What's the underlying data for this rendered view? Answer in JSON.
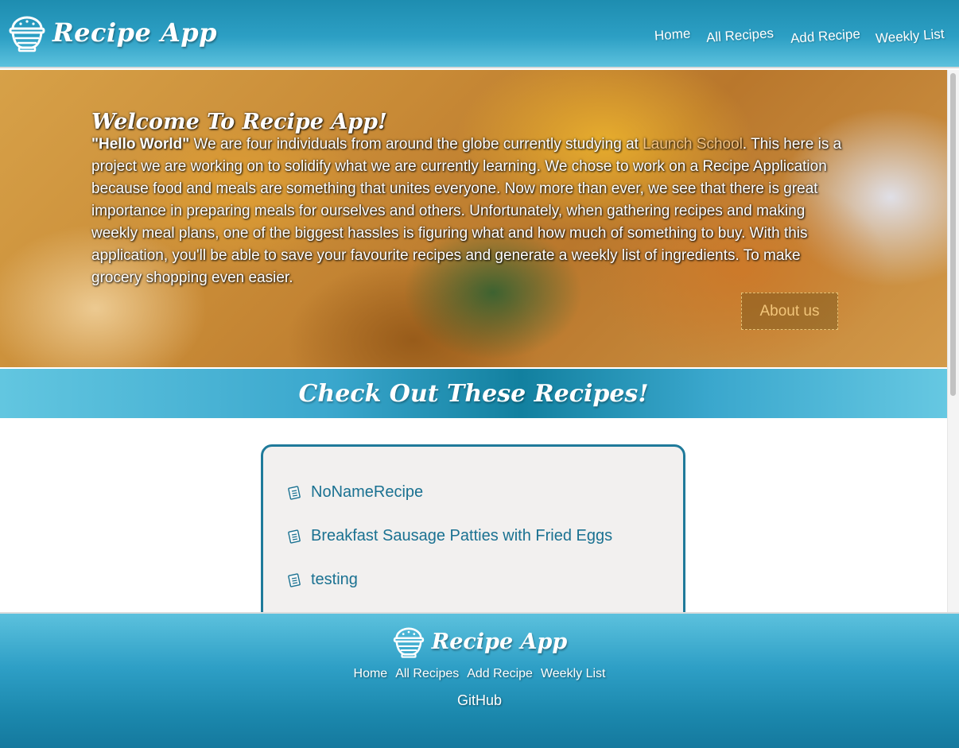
{
  "header": {
    "brand": "Recipe App",
    "nav": [
      "Home",
      "All Recipes",
      "Add Recipe",
      "Weekly List"
    ]
  },
  "hero": {
    "title": "Welcome To Recipe App!",
    "greeting": "\"Hello World\"",
    "intro": " We are four individuals from around the globe currently studying at ",
    "school_link": "Launch School",
    "body": ". This here is a project we are working on to solidify what we are currently learning. We chose to work on a Recipe Application because food and meals are something that unites everyone. Now more than ever, we see that there is great importance in preparing meals for ourselves and others. Unfortunately, when gathering recipes and making weekly meal plans, one of the biggest hassles is figuring what and how much of something to buy. With this application, you'll be able to save your favourite recipes and generate a weekly list of ingredients. To make grocery shopping even easier.",
    "about_button": "About us"
  },
  "section": {
    "title": "Check Out These Recipes!"
  },
  "recipes": [
    {
      "name": "NoNameRecipe",
      "icon": "recipe-sheet-icon"
    },
    {
      "name": "Breakfast Sausage Patties with Fried Eggs",
      "icon": "recipe-sheet-icon"
    },
    {
      "name": "testing",
      "icon": "recipe-sheet-icon"
    }
  ],
  "footer": {
    "brand": "Recipe App",
    "nav": [
      "Home",
      "All Recipes",
      "Add Recipe",
      "Weekly List"
    ],
    "github": "GitHub"
  },
  "colors": {
    "header_teal": "#2c9fc4",
    "accent_dark_teal": "#1f7a9a",
    "link_orange": "#f3c384",
    "card_bg": "#f2f0ef"
  }
}
